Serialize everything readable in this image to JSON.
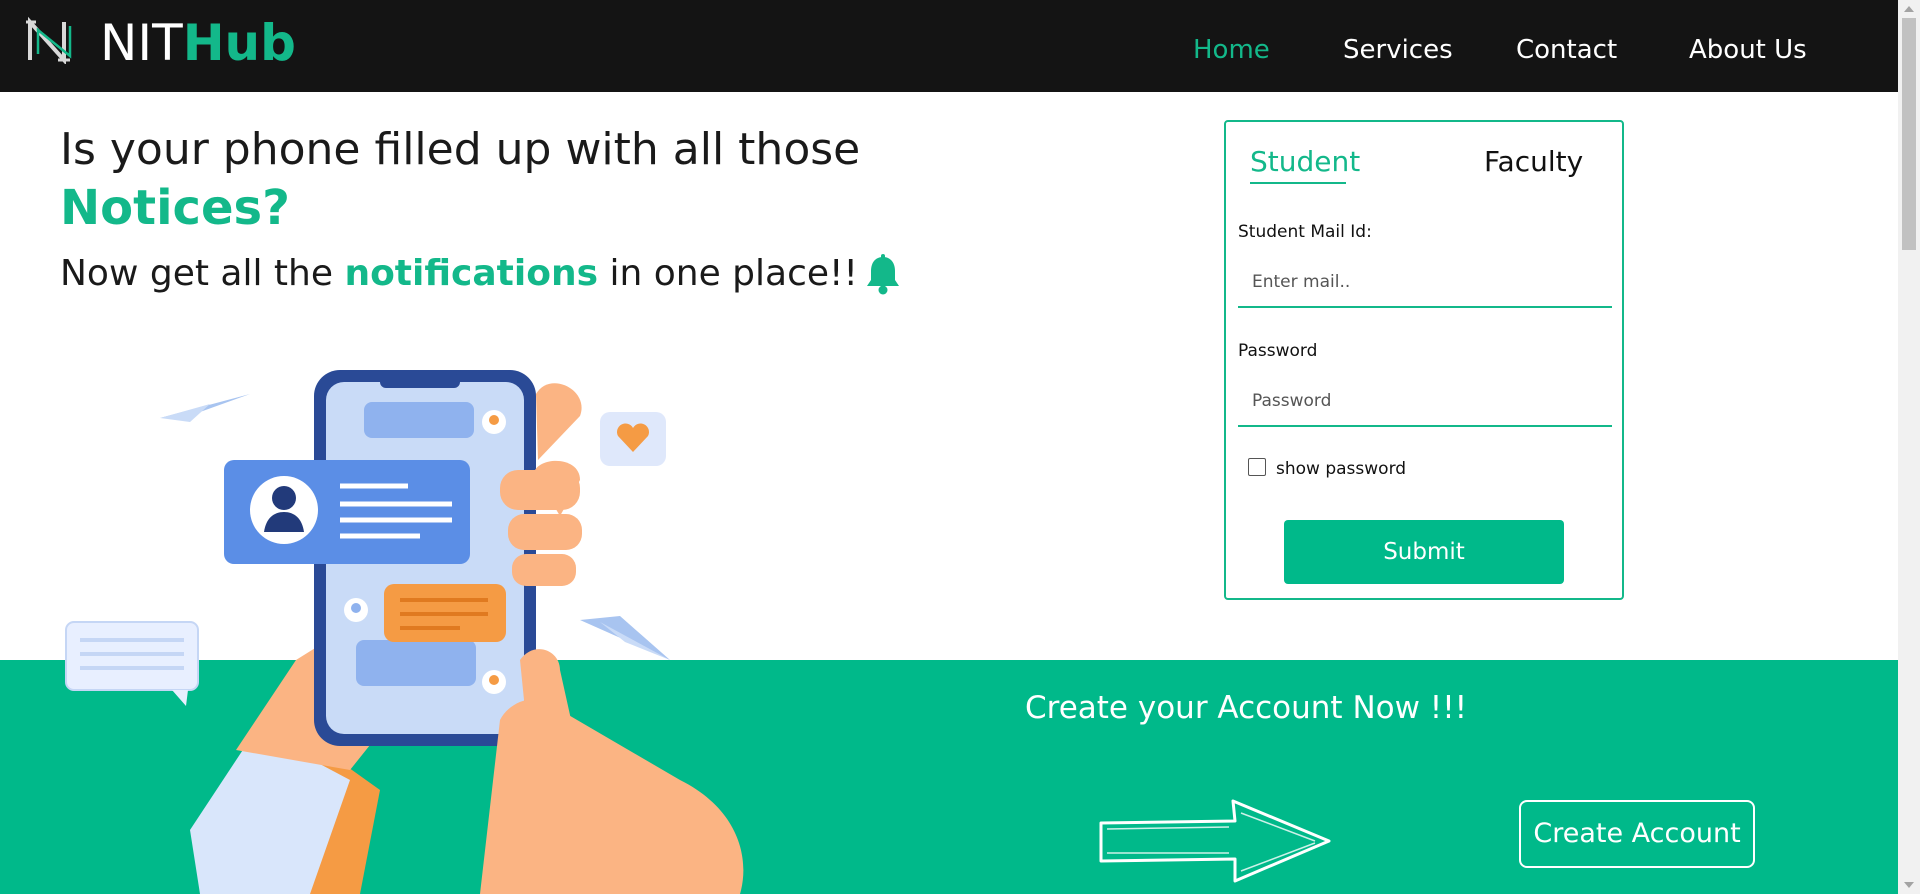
{
  "brand": {
    "name_prefix": "NIT",
    "name_suffix": "Hub",
    "color": "#13b88a"
  },
  "nav": {
    "home": "Home",
    "services": "Services",
    "contact": "Contact",
    "about": "About Us",
    "active": "Home"
  },
  "hero": {
    "line1": "Is your phone filled up with all those",
    "line2": "Notices?",
    "line3_prefix": "Now get all the ",
    "line3_emphasis": "notifications",
    "line3_suffix": " in one place!!",
    "icon": "bell-icon"
  },
  "login": {
    "tabs": [
      "Student",
      "Faculty"
    ],
    "active_tab": "Student",
    "mail_label": "Student Mail Id:",
    "mail_placeholder": "Enter mail..",
    "mail_value": "",
    "password_label": "Password",
    "password_placeholder": "Password",
    "password_value": "",
    "show_password_label": "show password",
    "show_password_checked": false,
    "submit_label": "Submit"
  },
  "signup_band": {
    "title": "Create your Account Now !!!",
    "button_label": "Create Account",
    "icon": "arrow-right-icon"
  },
  "colors": {
    "accent": "#13b88a",
    "band": "#00b98a",
    "navbar": "#141414"
  }
}
